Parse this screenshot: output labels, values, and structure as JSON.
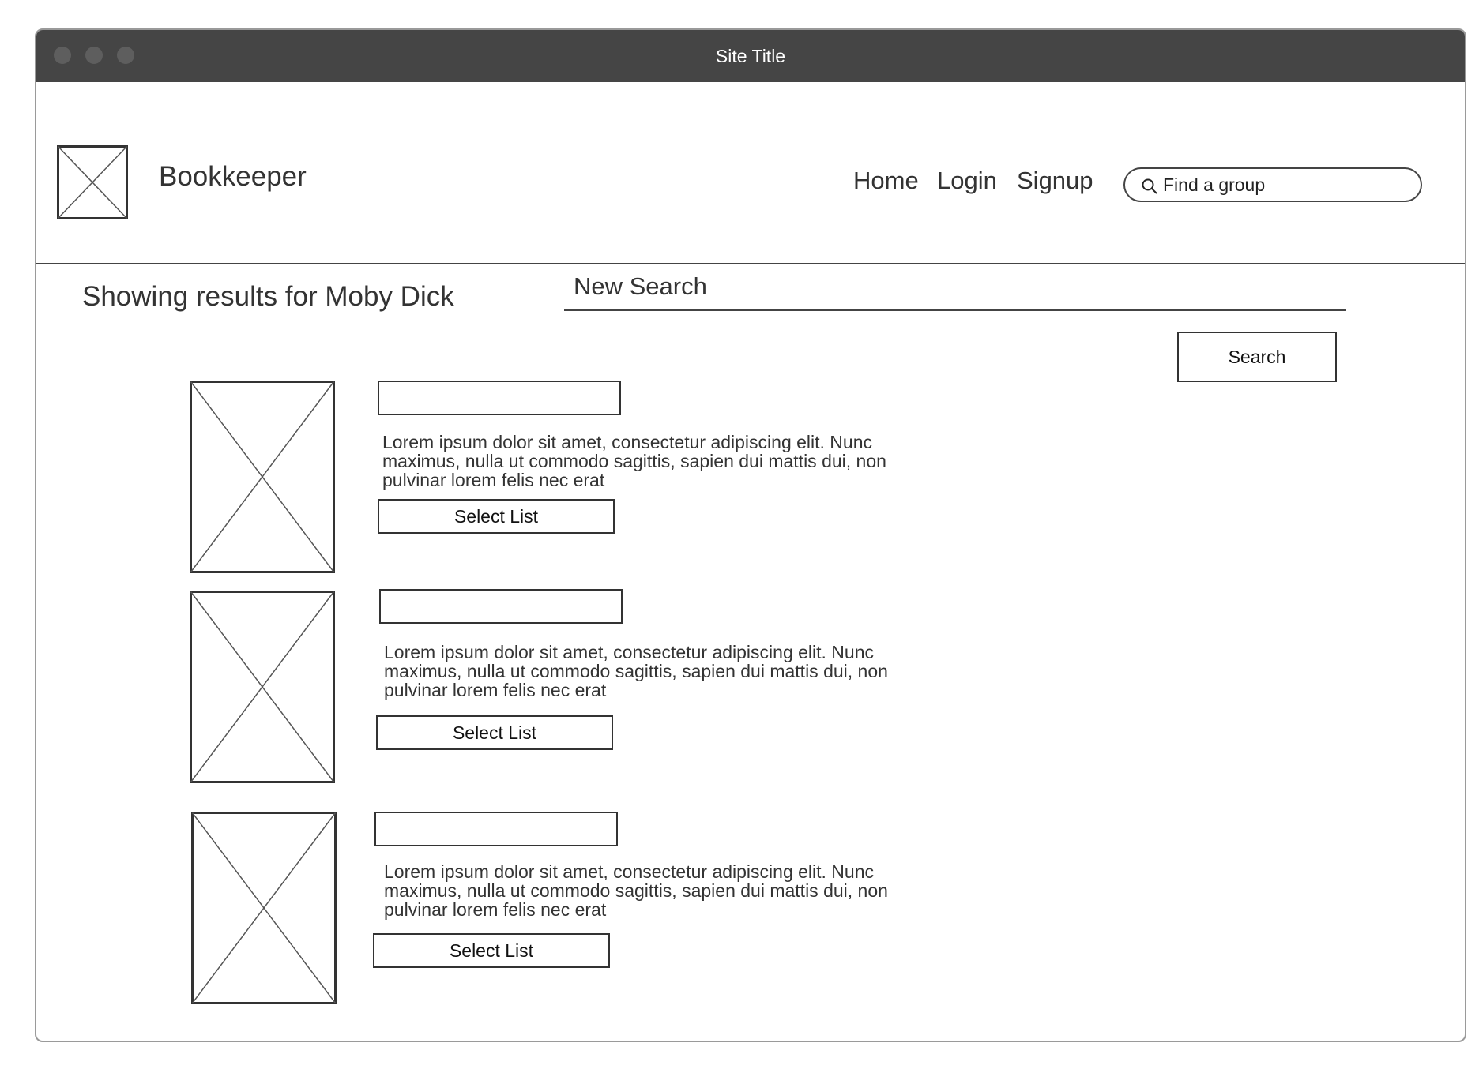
{
  "window": {
    "title": "Site Title"
  },
  "header": {
    "brand": "Bookkeeper",
    "nav": {
      "home": "Home",
      "login": "Login",
      "signup": "Signup"
    },
    "search_placeholder": "Find a group"
  },
  "main": {
    "results_heading": "Showing results for Moby Dick",
    "new_search_placeholder": "New Search",
    "search_button_label": "Search",
    "results": [
      {
        "description": "Lorem ipsum dolor sit amet, consectetur adipiscing elit. Nunc maximus, nulla ut commodo sagittis, sapien dui mattis dui, non pulvinar lorem felis nec erat",
        "button_label": "Select List"
      },
      {
        "description": "Lorem ipsum dolor sit amet, consectetur adipiscing elit. Nunc maximus, nulla ut commodo sagittis, sapien dui mattis dui, non pulvinar lorem felis nec erat",
        "button_label": "Select List"
      },
      {
        "description": "Lorem ipsum dolor sit amet, consectetur adipiscing elit. Nunc maximus, nulla ut commodo sagittis, sapien dui mattis dui, non pulvinar lorem felis nec erat",
        "button_label": "Select List"
      }
    ]
  },
  "icons": {
    "logo": "image-placeholder-icon",
    "search": "search-icon",
    "result_image": "image-placeholder-icon"
  },
  "colors": {
    "titlebar": "#454545",
    "window_dot": "#5e5e5e",
    "outline": "#333333"
  }
}
